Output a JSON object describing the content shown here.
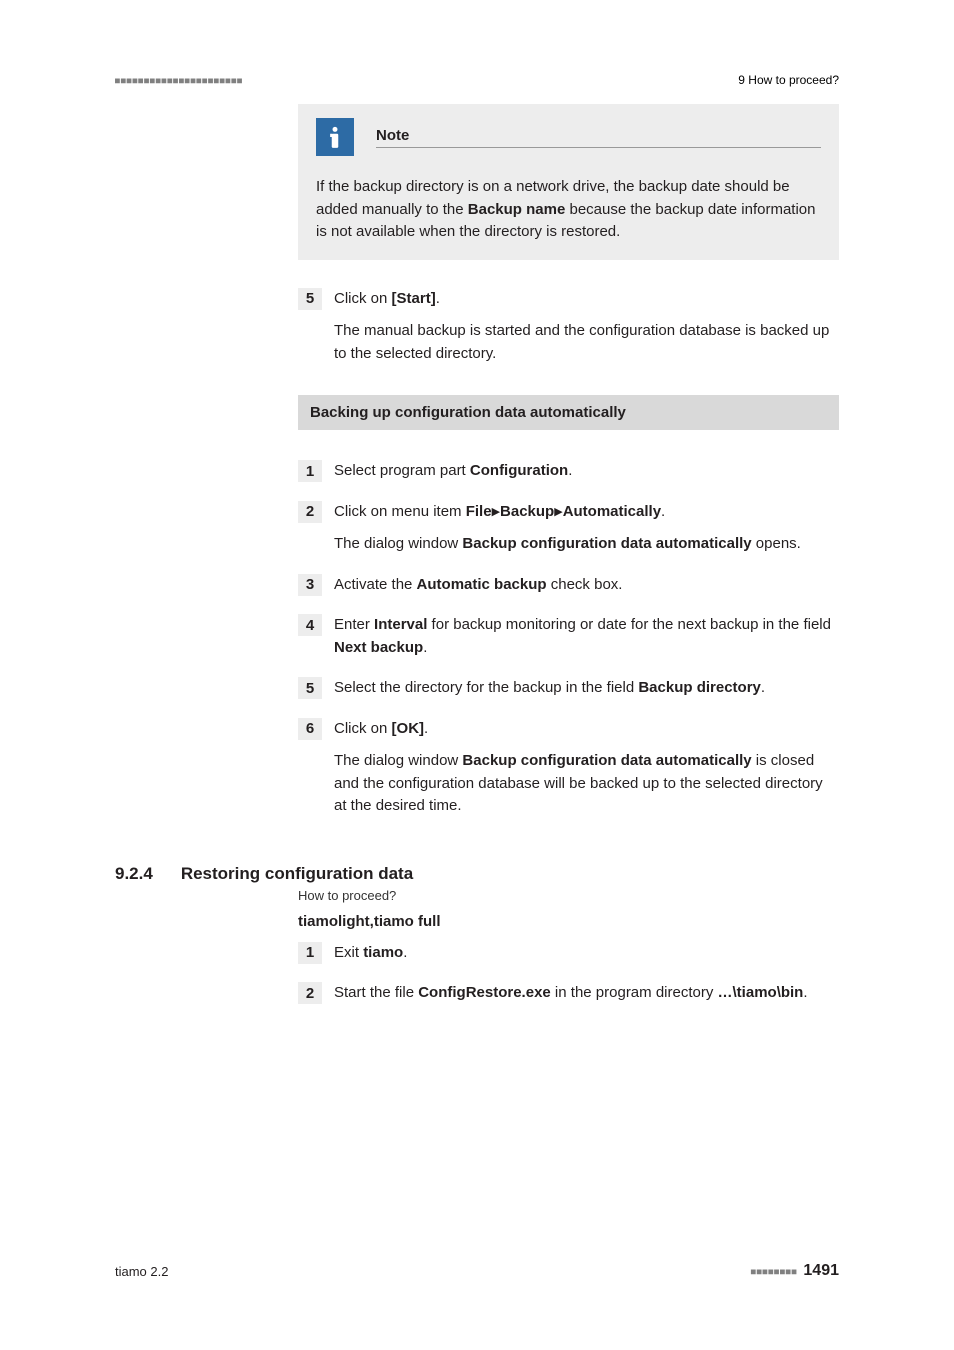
{
  "header": {
    "left_ticks": "■■■■■■■■■■■■■■■■■■■■■■",
    "right_label": "9 How to proceed?"
  },
  "note": {
    "title": "Note",
    "text_prefix": "If the backup directory is on a network drive, the backup date should be added manually to the ",
    "text_bold": "Backup name",
    "text_suffix": " because the backup date information is not available when the directory is restored."
  },
  "step5": {
    "num": "5",
    "line1_pre": "Click on ",
    "line1_bold": "[Start]",
    "line1_post": ".",
    "para2": "The manual backup is started and the configuration database is backed up to the selected directory."
  },
  "section_bar": "Backing up configuration data automatically",
  "auto_steps": [
    {
      "num": "1",
      "parts": [
        {
          "t": "Select program part "
        },
        {
          "t": "Configuration",
          "b": true
        },
        {
          "t": "."
        }
      ]
    },
    {
      "num": "2",
      "parts": [
        {
          "t": "Click on menu item "
        },
        {
          "t": "File",
          "b": true
        },
        {
          "t": " ▸ ",
          "arrow": true
        },
        {
          "t": "Backup",
          "b": true
        },
        {
          "t": " ▸ ",
          "arrow": true
        },
        {
          "t": "Automatically",
          "b": true
        },
        {
          "t": "."
        }
      ],
      "para2_parts": [
        {
          "t": "The dialog window "
        },
        {
          "t": "Backup configuration data automatically",
          "b": true
        },
        {
          "t": " opens."
        }
      ]
    },
    {
      "num": "3",
      "parts": [
        {
          "t": "Activate the "
        },
        {
          "t": "Automatic backup",
          "b": true
        },
        {
          "t": " check box."
        }
      ]
    },
    {
      "num": "4",
      "parts": [
        {
          "t": "Enter "
        },
        {
          "t": "Interval",
          "b": true
        },
        {
          "t": " for backup monitoring or date for the next backup in the field "
        },
        {
          "t": "Next backup",
          "b": true
        },
        {
          "t": "."
        }
      ]
    },
    {
      "num": "5",
      "parts": [
        {
          "t": "Select the directory for the backup in the field "
        },
        {
          "t": "Backup directory",
          "b": true
        },
        {
          "t": "."
        }
      ]
    },
    {
      "num": "6",
      "parts": [
        {
          "t": "Click on "
        },
        {
          "t": "[OK]",
          "b": true
        },
        {
          "t": "."
        }
      ],
      "para2_parts": [
        {
          "t": "The dialog window "
        },
        {
          "t": "Backup configuration data automatically",
          "b": true
        },
        {
          "t": " is closed and the configuration database will be backed up to the selected directory at the desired time."
        }
      ]
    }
  ],
  "section924": {
    "num": "9.2.4",
    "title": "Restoring configuration data",
    "breadcrumb": "How to proceed?",
    "sub_bold": "tiamolight,tiamo full",
    "steps": [
      {
        "num": "1",
        "parts": [
          {
            "t": "Exit "
          },
          {
            "t": "tiamo",
            "b": true
          },
          {
            "t": "."
          }
        ]
      },
      {
        "num": "2",
        "parts": [
          {
            "t": "Start the file "
          },
          {
            "t": "ConfigRestore.exe",
            "b": true
          },
          {
            "t": " in the program directory "
          },
          {
            "t": "…\\tiamo\\bin",
            "b": true
          },
          {
            "t": "."
          }
        ]
      }
    ]
  },
  "footer": {
    "left": "tiamo 2.2",
    "ticks": "■■■■■■■■",
    "page": "1491"
  }
}
